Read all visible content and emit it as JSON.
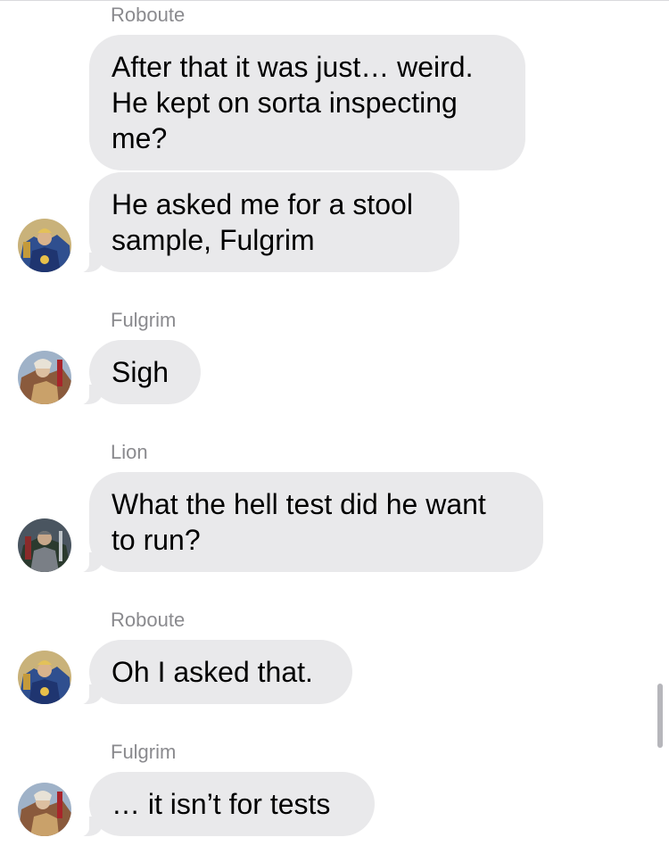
{
  "messages": [
    {
      "sender": "Roboute",
      "bubbles": [
        "After that it was just… weird.\nHe kept on sorta inspecting\nme?",
        "He asked me for a stool\nsample, Fulgrim"
      ]
    },
    {
      "sender": "Fulgrim",
      "bubbles": [
        "Sigh"
      ]
    },
    {
      "sender": "Lion",
      "bubbles": [
        "What the hell test did he want\nto run?"
      ]
    },
    {
      "sender": "Roboute",
      "bubbles": [
        "Oh I asked that."
      ]
    },
    {
      "sender": "Fulgrim",
      "bubbles": [
        "… it isn’t for tests"
      ]
    }
  ],
  "avatars": [
    {
      "person": "Roboute",
      "icon": "roboute-avatar-icon"
    },
    {
      "person": "Fulgrim",
      "icon": "fulgrim-avatar-icon"
    },
    {
      "person": "Lion",
      "icon": "lion-avatar-icon"
    }
  ],
  "colors": {
    "bubble": "#e9e9eb",
    "sender_name": "#8a8a8e",
    "background": "#ffffff",
    "scrollbar": "#b6b6bb"
  }
}
